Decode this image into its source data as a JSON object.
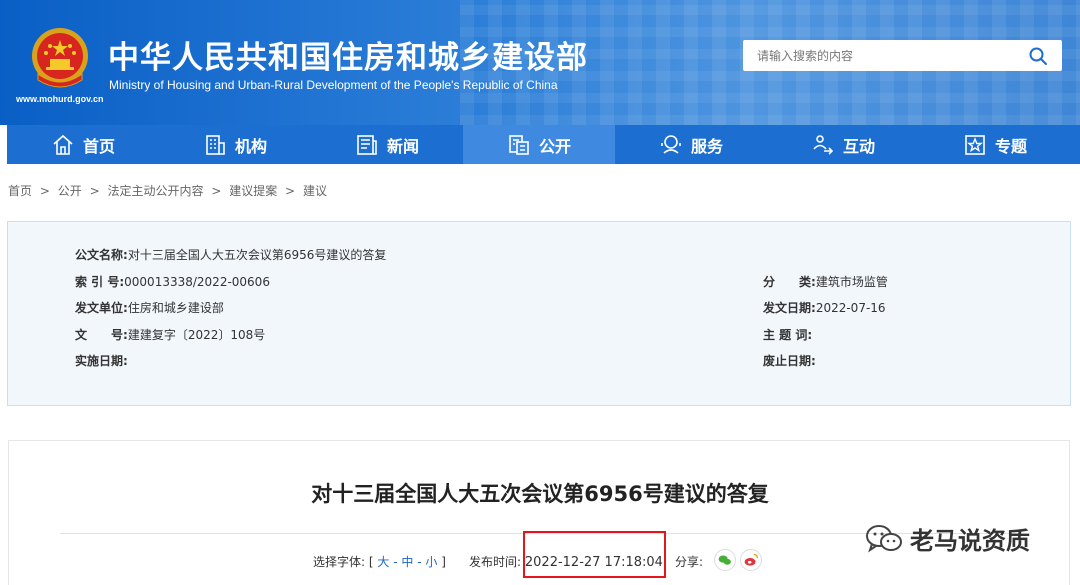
{
  "header": {
    "site_title": "中华人民共和国住房和城乡建设部",
    "site_subtitle": "Ministry of Housing and Urban-Rural Development of the People's Republic of China",
    "site_url": "www.mohurd.gov.cn",
    "search_placeholder": "请输入搜索的内容"
  },
  "nav": [
    {
      "label": "首页",
      "icon": "home-icon"
    },
    {
      "label": "机构",
      "icon": "building-icon"
    },
    {
      "label": "新闻",
      "icon": "news-icon"
    },
    {
      "label": "公开",
      "icon": "disclosure-icon",
      "active": true
    },
    {
      "label": "服务",
      "icon": "service-icon"
    },
    {
      "label": "互动",
      "icon": "interaction-icon"
    },
    {
      "label": "专题",
      "icon": "special-topic-icon"
    }
  ],
  "breadcrumb": [
    "首页",
    ">",
    "公开",
    ">",
    "法定主动公开内容",
    ">",
    "建议提案",
    ">",
    "建议"
  ],
  "info": {
    "doc_name_label": "公文名称:",
    "doc_name": "对十三届全国人大五次会议第6956号建议的答复",
    "index_label": "索 引 号:",
    "index": "000013338/2022-00606",
    "category_label": "分　　类:",
    "category": "建筑市场监管",
    "issuer_label": "发文单位:",
    "issuer": "住房和城乡建设部",
    "issue_date_label": "发文日期:",
    "issue_date": "2022-07-16",
    "doc_no_label": "文　　号:",
    "doc_no": "建建复字〔2022〕108号",
    "subject_label": "主 题 词:",
    "subject": "",
    "effective_label": "实施日期:",
    "effective": "",
    "expiry_label": "废止日期:",
    "expiry": ""
  },
  "article": {
    "title": "对十三届全国人大五次会议第6956号建议的答复",
    "font_select_label": "选择字体:",
    "font_bracket_open": "[",
    "font_large": "大",
    "font_sep1": "-",
    "font_medium": "中",
    "font_sep2": "-",
    "font_small": "小",
    "font_bracket_close": "]",
    "publish_label": "发布时间:",
    "publish_time": "2022-12-27 17:18:04",
    "share_label": "分享:"
  },
  "watermark": {
    "text": "老马说资质"
  },
  "colors": {
    "header_blue": "#0a5fc6",
    "nav_blue": "#1c6fd0",
    "nav_active": "#3f8ae0",
    "highlight_red": "#e4161b",
    "link_blue": "#2066c8"
  }
}
